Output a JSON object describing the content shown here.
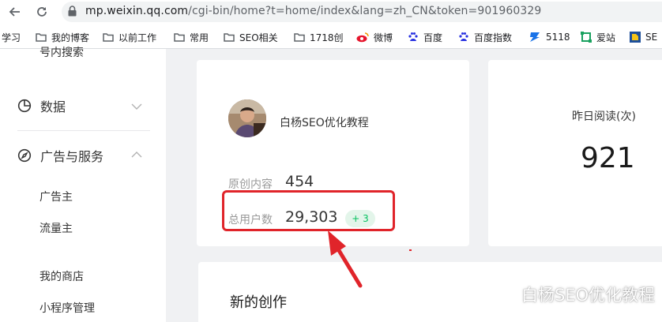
{
  "browser": {
    "url_host": "mp.weixin.qq.com",
    "url_rest": "/cgi-bin/home?t=home/index&lang=zh_CN&token=901960329",
    "bookmarks": [
      {
        "label": "学习",
        "icon": "folder-icon"
      },
      {
        "label": "我的博客",
        "icon": "folder-icon"
      },
      {
        "label": "以前工作",
        "icon": "folder-icon"
      },
      {
        "label": "常用",
        "icon": "folder-icon"
      },
      {
        "label": "SEO相关",
        "icon": "folder-icon"
      },
      {
        "label": "1718创",
        "icon": "folder-icon"
      },
      {
        "label": "微博",
        "icon": "weibo-icon"
      },
      {
        "label": "百度",
        "icon": "baidu-icon"
      },
      {
        "label": "百度指数",
        "icon": "baidu-icon"
      },
      {
        "label": "5118",
        "icon": "5118-icon"
      },
      {
        "label": "爱站",
        "icon": "aizhan-icon"
      },
      {
        "label": "SE",
        "icon": "seo-icon"
      }
    ]
  },
  "sidebar": {
    "cut_item": "号内搜索",
    "groups": [
      {
        "label": "数据",
        "icon": "chart-pie-icon",
        "expanded": false
      },
      {
        "label": "广告与服务",
        "icon": "compass-icon",
        "expanded": true
      }
    ],
    "items": [
      "广告主",
      "流量主",
      "我的商店",
      "小程序管理"
    ]
  },
  "account": {
    "name": "白杨SEO优化教程",
    "original_label": "原创内容",
    "original_value": "454",
    "users_label": "总用户数",
    "users_value": "29,303",
    "users_delta": "+ 3"
  },
  "yesterday": {
    "label": "昨日阅读(次)",
    "value": "921"
  },
  "creation": {
    "title": "新的创作"
  },
  "watermark": {
    "text": "白杨SEO优化教程"
  },
  "colors": {
    "accent_green": "#07c160",
    "annotation_red": "#e0242a"
  }
}
